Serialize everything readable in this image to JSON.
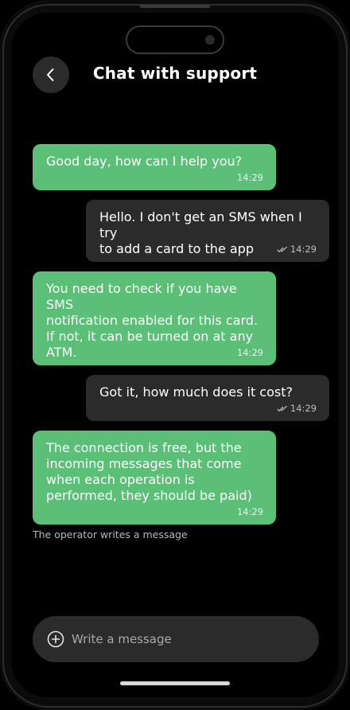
{
  "header": {
    "title": "Chat with support",
    "back_icon": "chevron-left-icon"
  },
  "messages": [
    {
      "sender": "support",
      "text": "Good day, how can I help you?",
      "time": "14:29"
    },
    {
      "sender": "user",
      "text": "Hello. I don't get an SMS when I try\nto add a card to the app",
      "time": "14:29",
      "status_icon": "double-check-icon"
    },
    {
      "sender": "support",
      "text": "You need to check if you have SMS\nnotification enabled for this card.\nIf not, it can be turned on at any\nATM.",
      "time": "14:29"
    },
    {
      "sender": "user",
      "text": "Got it, how much does it cost?",
      "time": "14:29",
      "status_icon": "double-check-icon"
    },
    {
      "sender": "support",
      "text": "The connection is free, but the\nincoming messages that come\nwhen each operation is\nperformed, they should be paid)",
      "time": "14:29"
    }
  ],
  "typing_status": "The operator writes a message",
  "composer": {
    "placeholder": "Write a message",
    "add_icon": "plus-circle-icon"
  },
  "colors": {
    "support_bubble": "#5cbf78",
    "user_bubble": "#2b2b2b",
    "background": "#000000"
  }
}
